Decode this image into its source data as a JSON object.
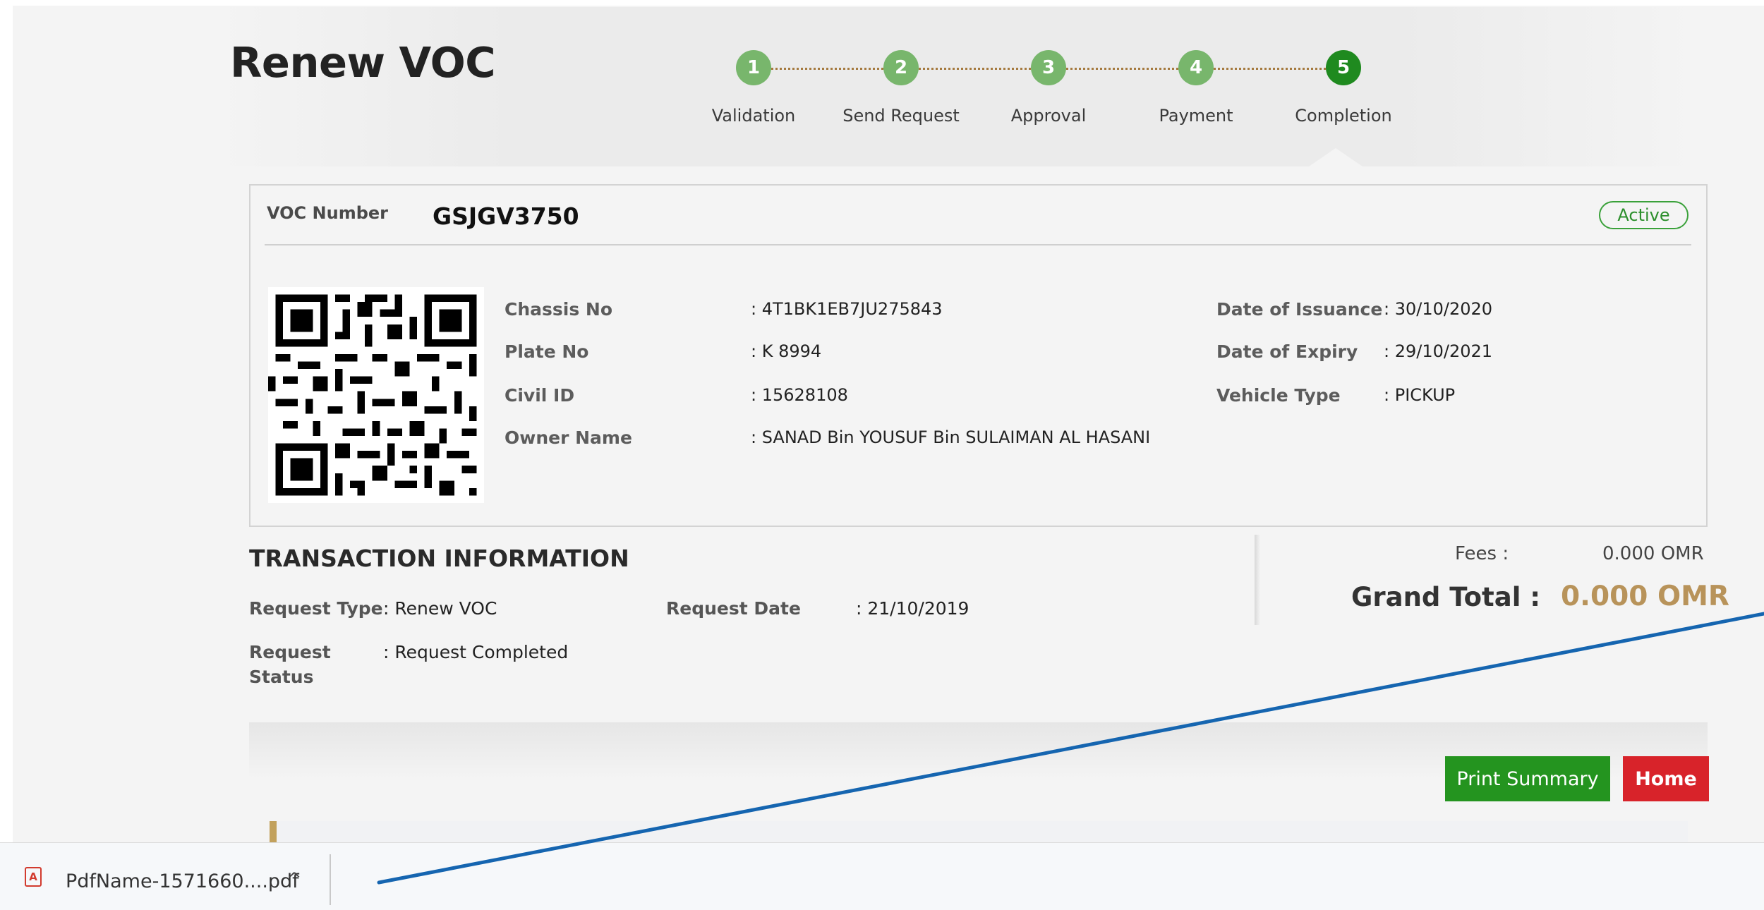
{
  "page": {
    "title": "Renew VOC"
  },
  "stepper": {
    "steps": [
      {
        "number": "1",
        "label": "Validation"
      },
      {
        "number": "2",
        "label": "Send Request"
      },
      {
        "number": "3",
        "label": "Approval"
      },
      {
        "number": "4",
        "label": "Payment"
      },
      {
        "number": "5",
        "label": "Completion"
      }
    ],
    "active_step": 5
  },
  "voc": {
    "label": "VOC Number",
    "number": "GSJGV3750",
    "status": "Active",
    "details_left": [
      {
        "label": "Chassis No",
        "value": ": 4T1BK1EB7JU275843"
      },
      {
        "label": "Plate No",
        "value": ": K 8994"
      },
      {
        "label": "Civil ID",
        "value": ": 15628108"
      },
      {
        "label": "Owner Name",
        "value": ": SANAD Bin YOUSUF Bin SULAIMAN AL HASANI"
      }
    ],
    "details_right": [
      {
        "label": "Date of Issuance",
        "value": ": 30/10/2020"
      },
      {
        "label": "Date of Expiry",
        "value": ": 29/10/2021"
      },
      {
        "label": "Vehicle Type",
        "value": ": PICKUP"
      }
    ]
  },
  "transaction": {
    "title": "TRANSACTION INFORMATION",
    "request_type_label": "Request Type",
    "request_type_value": ": Renew VOC",
    "request_date_label": "Request Date",
    "request_date_value": ": 21/10/2019",
    "request_status_label_1": "Request",
    "request_status_label_2": "Status",
    "request_status_value": ": Request Completed"
  },
  "fees": {
    "fees_label": "Fees :",
    "fees_value": "0.000 OMR",
    "total_label": "Grand Total :",
    "total_value": "0.000 OMR"
  },
  "actions": {
    "print_label": "Print Summary",
    "home_label": "Home"
  },
  "download": {
    "file_name": "PdfName-1571660....pdf",
    "chevron": "^"
  },
  "colors": {
    "step_done": "#78b66c",
    "step_active": "#1f8a1f",
    "print_button": "#24941f",
    "home_button": "#d8232a",
    "grand_total": "#b8935a",
    "annotation_line": "#1565b0"
  }
}
